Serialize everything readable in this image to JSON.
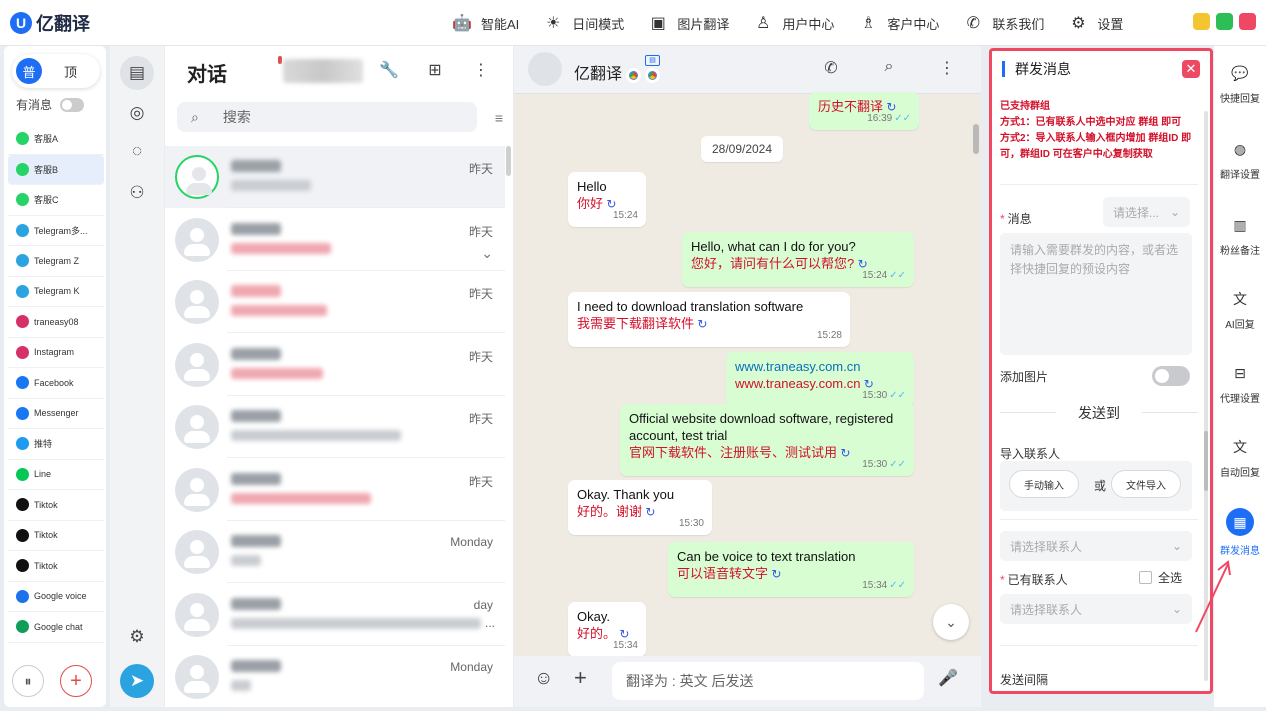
{
  "app": {
    "name": "亿翻译",
    "logo_letter": "U"
  },
  "titlebar": {
    "items": [
      {
        "label": "智能AI",
        "icon": "robot-icon",
        "glyph": "🤖"
      },
      {
        "label": "日间模式",
        "icon": "sun-icon",
        "glyph": "☀"
      },
      {
        "label": "图片翻译",
        "icon": "image-translate-icon",
        "glyph": "▣"
      },
      {
        "label": "用户中心",
        "icon": "user-icon",
        "glyph": "♙"
      },
      {
        "label": "客户中心",
        "icon": "customer-icon",
        "glyph": "♗"
      },
      {
        "label": "联系我们",
        "icon": "phone-icon",
        "glyph": "✆"
      },
      {
        "label": "设置",
        "icon": "gear-icon",
        "glyph": "⚙"
      }
    ],
    "window_colors": [
      "#f5c531",
      "#2dbf56",
      "#ee4863"
    ]
  },
  "accounts": {
    "segment": {
      "on": "普",
      "off": "顶"
    },
    "has_message_label": "有消息",
    "list": [
      {
        "label": "客服A",
        "color": "#25d366"
      },
      {
        "label": "客服B",
        "color": "#25d366",
        "selected": true
      },
      {
        "label": "客服C",
        "color": "#25d366"
      },
      {
        "label": "Telegram多...",
        "color": "#2aa3e0"
      },
      {
        "label": "Telegram Z",
        "color": "#2aa3e0"
      },
      {
        "label": "Telegram K",
        "color": "#2aa3e0"
      },
      {
        "label": "traneasy08",
        "color": "#d6306b"
      },
      {
        "label": "Instagram",
        "color": "#d6306b"
      },
      {
        "label": "Facebook",
        "color": "#1877f2"
      },
      {
        "label": "Messenger",
        "color": "#1877f2"
      },
      {
        "label": "推特",
        "color": "#1d9bf0"
      },
      {
        "label": "Line",
        "color": "#06c755"
      },
      {
        "label": "Tiktok",
        "color": "#111111"
      },
      {
        "label": "Tiktok",
        "color": "#111111"
      },
      {
        "label": "Tiktok",
        "color": "#111111"
      },
      {
        "label": "Google voice",
        "color": "#1a73e8"
      },
      {
        "label": "Google chat",
        "color": "#0f9d58"
      }
    ],
    "collapse_glyph": "⏸",
    "add_glyph": "+"
  },
  "chatlist": {
    "title": "对话",
    "search_placeholder": "搜索",
    "search_glyph": "⌕",
    "tool_glyphs": {
      "wrench": "🔧",
      "new": "⊞",
      "more": "⋮"
    },
    "filter_glyph": "≡",
    "chats": [
      {
        "time": "昨天",
        "ring": true,
        "msg_red": false,
        "selected": true
      },
      {
        "time": "昨天",
        "chevron": "⌄",
        "msg_red": true
      },
      {
        "time": "昨天",
        "msg_red": true
      },
      {
        "time": "昨天",
        "msg_red": true
      },
      {
        "time": "昨天",
        "msg_red": false
      },
      {
        "time": "昨天",
        "msg_red": true
      },
      {
        "time": "Monday",
        "msg_red": false
      },
      {
        "time": "day",
        "msg_red": false,
        "preview_suffix": "..."
      },
      {
        "time": "Monday",
        "msg_red": false
      }
    ]
  },
  "conversation": {
    "name": "亿翻译",
    "date_chip": "28/09/2024",
    "input_placeholder": "翻译为 : 英文 后发送",
    "glyphs": {
      "call": "✆",
      "search": "⌕",
      "more": "⋮",
      "emoji": "☺",
      "plus": "+",
      "mic": "🎤",
      "down": "⌄"
    },
    "messages": [
      {
        "dir": "out",
        "t1": "",
        "t2": "历史不翻译",
        "time": "16:39"
      },
      {
        "dir": "in",
        "t1": "Hello",
        "t2": "你好",
        "time": "15:24"
      },
      {
        "dir": "out",
        "t1": "Hello, what can I do for you?",
        "t2": "您好，请问有什么可以帮您?",
        "time": "15:24"
      },
      {
        "dir": "in",
        "t1": "I need to download translation software",
        "t2": "我需要下载翻译软件",
        "time": "15:28"
      },
      {
        "dir": "out",
        "t1": "www.traneasy.com.cn",
        "t2": "www.traneasy.com.cn",
        "time": "15:30",
        "t1_color": "#0b6fb8"
      },
      {
        "dir": "out",
        "t1": "Official website download software, registered account, test trial",
        "t2": "官网下载软件、注册账号、测试试用",
        "time": "15:30"
      },
      {
        "dir": "in",
        "t1": "Okay. Thank you",
        "t2": "好的。谢谢",
        "time": "15:30"
      },
      {
        "dir": "out",
        "t1": "Can be voice to text translation",
        "t2": "可以语音转文字",
        "time": "15:34"
      },
      {
        "dir": "in",
        "t1": "Okay.",
        "t2": "好的。",
        "time": "15:34"
      }
    ]
  },
  "broadcast": {
    "title": "群发消息",
    "close_glyph": "✕",
    "note": "已支持群组\n方式1：已有联系人中选中对应 群组 即可\n方式2：导入联系人输入框内增加 群组ID 即可，群组ID 可在客户中心复制获取",
    "message_label": "消息",
    "select_placeholder": "请选择...",
    "message_placeholder": "请输入需要群发的内容，或者选择快捷回复的预设内容",
    "add_image_label": "添加图片",
    "send_to": "发送到",
    "import_label": "导入联系人",
    "manual_button": "手动输入",
    "or_text": "或",
    "file_button": "文件导入",
    "contact_placeholder": "请选择联系人",
    "existing_label": "已有联系人",
    "select_all": "全选",
    "interval_label": "发送间隔"
  },
  "sidebar": {
    "items": [
      {
        "label": "快捷回复",
        "glyph": "💬"
      },
      {
        "label": "翻译设置",
        "glyph": "◍"
      },
      {
        "label": "粉丝备注",
        "glyph": "▥"
      },
      {
        "label": "AI回复",
        "glyph": "文"
      },
      {
        "label": "代理设置",
        "glyph": "⊟"
      },
      {
        "label": "自动回复",
        "glyph": "文"
      },
      {
        "label": "群发消息",
        "glyph": "▦",
        "active": true
      }
    ]
  },
  "colors": {
    "accent": "#1e6ef5",
    "danger": "#ee4863",
    "whatsapp": "#25d366"
  }
}
